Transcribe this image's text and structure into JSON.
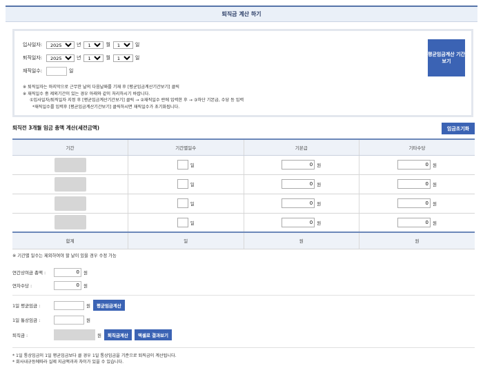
{
  "header": {
    "title": "퇴직금 계산 하기"
  },
  "dates": {
    "hire": {
      "label": "입사일자:",
      "year": "2025",
      "month": "1",
      "day": "1",
      "year_unit": "년",
      "month_unit": "월",
      "day_unit": "일"
    },
    "retire": {
      "label": "퇴직일자:",
      "year": "2025",
      "month": "1",
      "day": "1",
      "year_unit": "년",
      "month_unit": "월",
      "day_unit": "일"
    },
    "work_days": {
      "label": "재직일수:",
      "value": "",
      "unit": "일"
    },
    "notes": [
      "※ 퇴직일자는 마지막으로 근무한 날의 다음날짜를 기재 후 [평균임금계산기간보기] 클릭",
      "※ 재직일수 중 제외기간이 있는 경우 아래와 같이 처리하시기 바랍니다.",
      "①입사일자/퇴직일자 지정 후 [평균임금계산기간보기] 클릭 → ②재직일수 란에 입력한 후 → ③하단 기본급, 수당 등 입력",
      "*재직일수를 입력후 [평균임금계산기간보기] 클릭하시면 재직일수가 초기화됩니다."
    ],
    "avg_period_button": "평균임금계산 기간보기"
  },
  "wage_section": {
    "title": "퇴직전 3개월 임금 총액 계산(세전금액)",
    "reset_button": "임금초기화",
    "columns": [
      "기간",
      "기간별일수",
      "기본급",
      "기타수당"
    ],
    "rows": [
      {
        "days_unit": "일",
        "base": "0",
        "base_unit": "원",
        "other": "0",
        "other_unit": "원"
      },
      {
        "days_unit": "일",
        "base": "0",
        "base_unit": "원",
        "other": "0",
        "other_unit": "원"
      },
      {
        "days_unit": "일",
        "base": "0",
        "base_unit": "원",
        "other": "0",
        "other_unit": "원"
      },
      {
        "days_unit": "일",
        "base": "0",
        "base_unit": "원",
        "other": "0",
        "other_unit": "원"
      }
    ],
    "total": {
      "label": "합계",
      "days": "일",
      "base": "원",
      "other": "원"
    }
  },
  "period_note": "※ 기간별 일수는 제외하여야 할 날이 있을 경우 수정 가능",
  "bonus": {
    "label": "연간상여금 총액 :",
    "value": "0",
    "unit": "원"
  },
  "annual_leave": {
    "label": "연차수당 :",
    "value": "0",
    "unit": "원"
  },
  "avg_wage": {
    "label": "1일 평균임금 :",
    "value": "",
    "unit": "원",
    "button": "평균임금계산"
  },
  "ordinary_wage": {
    "label": "1일 통상임금 :",
    "value": "",
    "unit": "원"
  },
  "severance": {
    "label": "퇴직금 :",
    "unit": "원",
    "calc_button": "퇴직금계산",
    "excel_button": "엑셀로 결과보기"
  },
  "footnotes": [
    "* 1일 통상임금이 1일 평균임금보다 클 경우 1일 통상임금을 기준으로 퇴직금이 계산됩니다.",
    "* 회사내규등에따라 실제 지급액과과 차이가 있을 수 있습니다."
  ]
}
